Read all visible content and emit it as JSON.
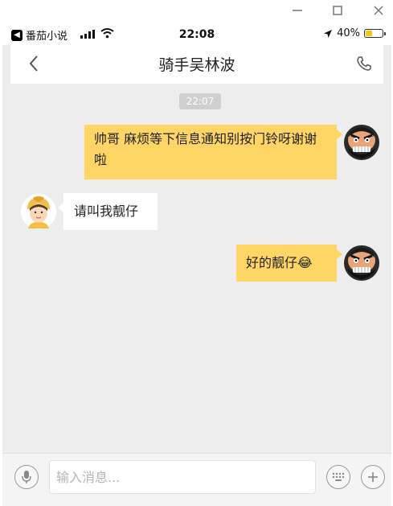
{
  "window": {
    "minimize_icon": "minimize-icon",
    "maximize_icon": "maximize-icon",
    "close_icon": "close-icon"
  },
  "status_bar": {
    "back_app": "番茄小说",
    "time": "22:08",
    "battery": "40%",
    "battery_level": 0.4,
    "battery_color": "#f5c518"
  },
  "nav": {
    "title": "骑手吴林波",
    "back_icon": "chevron-left-icon",
    "call_icon": "phone-icon"
  },
  "chat": {
    "timestamp": "22:07",
    "messages": [
      {
        "sender": "me",
        "text": "帅哥 麻烦等下信息通知别按门铃呀谢谢啦"
      },
      {
        "sender": "rider",
        "text": "请叫我靓仔"
      },
      {
        "sender": "me",
        "text": "好的靓仔",
        "emoji": "😂"
      }
    ]
  },
  "input_bar": {
    "placeholder": "输入消息...",
    "voice_icon": "microphone-icon",
    "keyboard_icon": "keyboard-icon",
    "add_icon": "plus-icon"
  },
  "colors": {
    "my_bubble": "#ffd566",
    "other_bubble": "#ffffff",
    "chat_background": "#ededed"
  }
}
